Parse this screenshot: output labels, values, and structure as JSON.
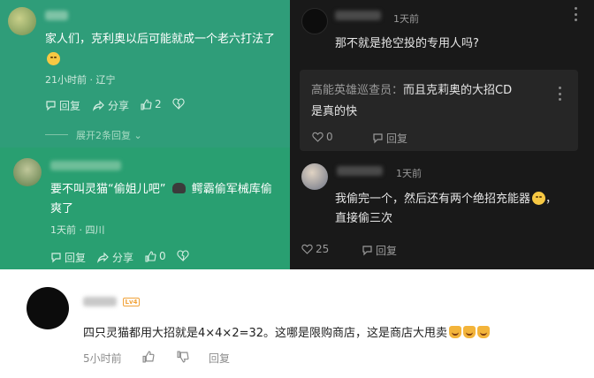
{
  "comment1": {
    "text_line1": "家人们，克利奥以后可能就成一个老六打法了",
    "meta": "21小时前 · 辽宁",
    "reply": "回复",
    "share": "分享",
    "like_count": "2",
    "expand": "展开2条回复"
  },
  "comment2": {
    "text_line1": "要不叫灵猫“偷姐儿吧”",
    "text_line1b": "鳄霸偷军械库偷",
    "text_line2": "爽了",
    "meta": "1天前 · 四川",
    "reply": "回复",
    "share": "分享",
    "like_count": "0"
  },
  "dark1": {
    "name": "¥小魔¥",
    "time": "1天前",
    "text": "那不就是抢空投的专用人吗?",
    "quote_author": "高能英雄巡查员：",
    "quote_text1": "而且克莉奥的大招CD",
    "quote_text2": "是真的快",
    "like_count": "0",
    "reply": "回复"
  },
  "dark2": {
    "name": "清枫下酒",
    "time": "1天前",
    "text_line1": "我偷完一个，然后还有两个绝招充能器",
    "text_line1_end": "，",
    "text_line2": "直接偷三次",
    "like_count": "25",
    "reply": "回复"
  },
  "white": {
    "name": "伴清泉",
    "level": "Lv4",
    "text": "四只灵猫都用大招就是4×4×2=32。这哪是限购商店，这是商店大甩卖",
    "time": "5小时前",
    "reply": "回复"
  },
  "colors": {
    "green_top": "#2f9d79",
    "green_bottom": "#299f71",
    "dark_bg": "#191919",
    "quote_bg": "#262626",
    "badge": "#f1a33b"
  }
}
